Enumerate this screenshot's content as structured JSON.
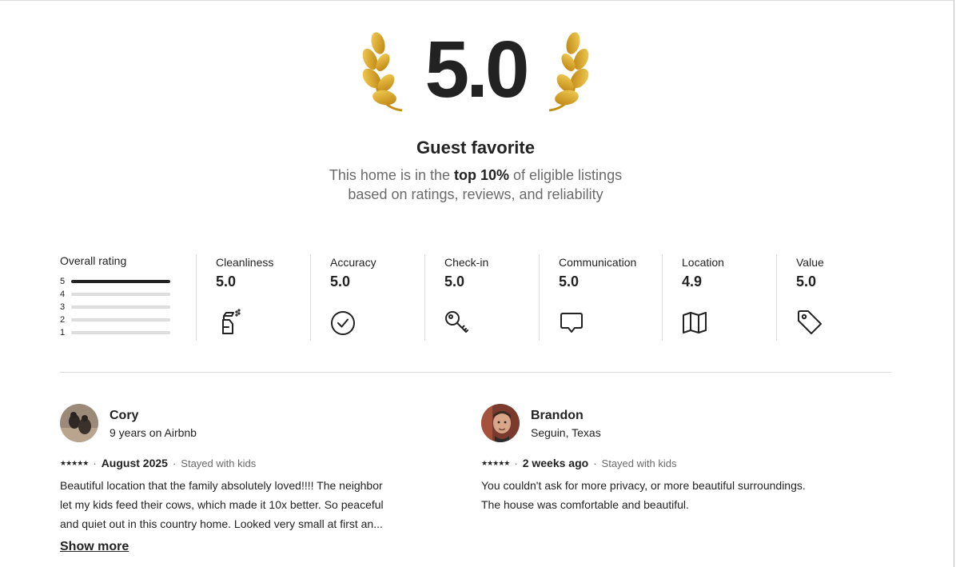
{
  "hero": {
    "score": "5.0",
    "title": "Guest favorite",
    "subtext_before": "This home is in the ",
    "subtext_bold": "top 10%",
    "subtext_after": " of eligible listings",
    "subtext_line2": "based on ratings, reviews, and reliability"
  },
  "overall": {
    "title": "Overall rating",
    "bars": [
      {
        "label": "5",
        "fraction": 1.0
      },
      {
        "label": "4",
        "fraction": 0.0
      },
      {
        "label": "3",
        "fraction": 0.0
      },
      {
        "label": "2",
        "fraction": 0.0
      },
      {
        "label": "1",
        "fraction": 0.0
      }
    ]
  },
  "categories": [
    {
      "title": "Cleanliness",
      "value": "5.0",
      "icon": "spray-bottle-icon"
    },
    {
      "title": "Accuracy",
      "value": "5.0",
      "icon": "check-circle-icon"
    },
    {
      "title": "Check-in",
      "value": "5.0",
      "icon": "key-icon"
    },
    {
      "title": "Communication",
      "value": "5.0",
      "icon": "chat-bubble-icon"
    },
    {
      "title": "Location",
      "value": "4.9",
      "icon": "map-icon"
    },
    {
      "title": "Value",
      "value": "5.0",
      "icon": "price-tag-icon"
    }
  ],
  "reviews": [
    {
      "name": "Cory",
      "sub": "9 years on Airbnb",
      "stars": "★★★★★",
      "date": "August 2025",
      "trip": "Stayed with kids",
      "body_lines": [
        "Beautiful location that the family absolutely loved!!!! The neighbor",
        "let my kids feed their cows, which made it 10x better. So peaceful",
        "and quiet out in this country home. Looked very small at first an..."
      ],
      "show_more": "Show more"
    },
    {
      "name": "Brandon",
      "sub": "Seguin, Texas",
      "stars": "★★★★★",
      "date": "2 weeks ago",
      "trip": "Stayed with kids",
      "body_lines": [
        "You couldn't ask for more privacy, or more beautiful surroundings.",
        "The house was comfortable and beautiful."
      ]
    }
  ],
  "colors": {
    "text": "#222222",
    "muted": "#6a6a6a",
    "divider": "#dddddd",
    "gold": "#d9a21b"
  }
}
